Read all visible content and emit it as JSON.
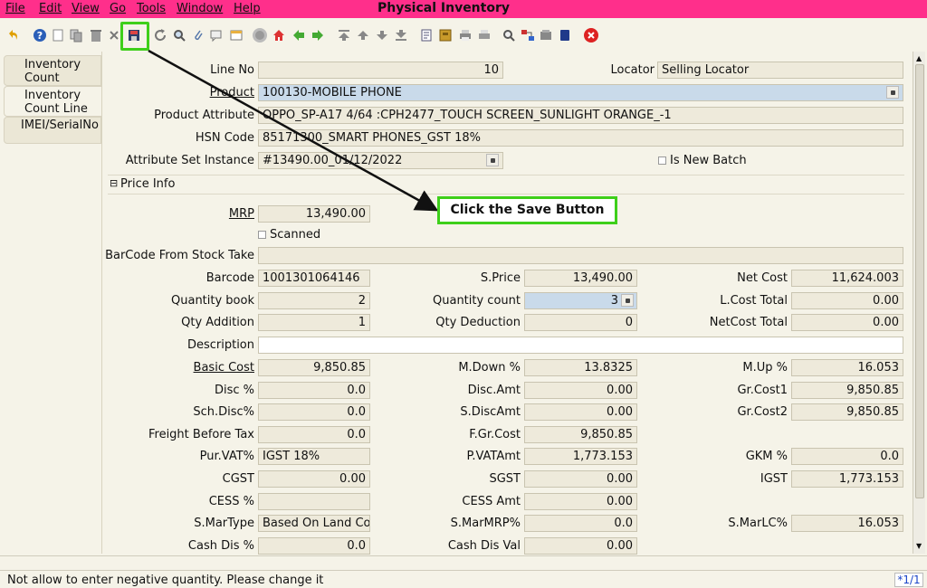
{
  "menu": [
    "File",
    "Edit",
    "View",
    "Go",
    "Tools",
    "Window",
    "Help"
  ],
  "app_title": "Physical Inventory",
  "toolbar_icons": [
    "undo-icon",
    "help-icon",
    "new-icon",
    "copy-icon",
    "delete-icon",
    "delete-selection-icon",
    "save-icon",
    "refresh-icon",
    "find-icon",
    "attachment-icon",
    "chat-icon",
    "history-icon",
    "home-icon",
    "parent-icon",
    "back-icon",
    "forward-icon",
    "first-icon",
    "previous-icon",
    "next-icon",
    "last-icon",
    "report-icon",
    "archive-icon",
    "print-icon",
    "print-preview-icon",
    "zoom-across-icon",
    "workflow-icon",
    "product-info-icon",
    "request-icon",
    "end-icon"
  ],
  "tabs": [
    "Inventory Count",
    "Inventory Count Line",
    "IMEI/SerialNo"
  ],
  "form": {
    "line_no_label": "Line No",
    "line_no": "10",
    "locator_label": "Locator",
    "locator": "Selling Locator",
    "product_label": "Product",
    "product": "100130-MOBILE PHONE",
    "product_attribute_label": "Product Attribute",
    "product_attribute": "OPPO_SP-A17 4/64 :CPH2477_TOUCH SCREEN_SUNLIGHT ORANGE_-1",
    "hsn_code_label": "HSN Code",
    "hsn_code": "85171300_SMART PHONES_GST 18%",
    "attribute_set_instance_label": "Attribute Set Instance",
    "attribute_set_instance": "#13490.00_01/12/2022",
    "is_new_batch_label": "Is New Batch",
    "price_info_label": "Price Info",
    "mrp_label": "MRP",
    "mrp": "13,490.00",
    "scanned_label": "Scanned",
    "barcode_from_stock_take_label": "BarCode From Stock Take",
    "barcode_from_stock_take": "",
    "barcode_label": "Barcode",
    "barcode": "1001301064146",
    "s_price_label": "S.Price",
    "s_price": "13,490.00",
    "net_cost_label": "Net Cost",
    "net_cost": "11,624.003",
    "quantity_book_label": "Quantity book",
    "quantity_book": "2",
    "quantity_count_label": "Quantity count",
    "quantity_count": "3",
    "l_cost_total_label": "L.Cost Total",
    "l_cost_total": "0.00",
    "qty_addition_label": "Qty Addition",
    "qty_addition": "1",
    "qty_deduction_label": "Qty Deduction",
    "qty_deduction": "0",
    "netcost_total_label": "NetCost Total",
    "netcost_total": "0.00",
    "description_label": "Description",
    "description": "",
    "basic_cost_label": "Basic Cost",
    "basic_cost": "9,850.85",
    "m_down_label": "M.Down %",
    "m_down": "13.8325",
    "m_up_label": "M.Up %",
    "m_up": "16.053",
    "disc_pct_label": "Disc %",
    "disc_pct": "0.0",
    "disc_amt_label": "Disc.Amt",
    "disc_amt": "0.00",
    "gr_cost1_label": "Gr.Cost1",
    "gr_cost1": "9,850.85",
    "sch_disc_label": "Sch.Disc%",
    "sch_disc": "0.0",
    "s_discamt_label": "S.DiscAmt",
    "s_discamt": "0.00",
    "gr_cost2_label": "Gr.Cost2",
    "gr_cost2": "9,850.85",
    "freight_label": "Freight Before Tax",
    "freight": "0.0",
    "f_gr_cost_label": "F.Gr.Cost",
    "f_gr_cost": "9,850.85",
    "pur_vat_label": "Pur.VAT%",
    "pur_vat": "IGST 18%",
    "p_vatamt_label": "P.VATAmt",
    "p_vatamt": "1,773.153",
    "gkm_label": "GKM %",
    "gkm": "0.0",
    "cgst_label": "CGST",
    "cgst": "0.00",
    "sgst_label": "SGST",
    "sgst": "0.00",
    "igst_label": "IGST",
    "igst": "1,773.153",
    "cess_pct_label": "CESS %",
    "cess_pct": "",
    "cess_amt_label": "CESS Amt",
    "cess_amt": "0.00",
    "s_martype_label": "S.MarType",
    "s_martype": "Based On Land Cost",
    "s_marmrp_label": "S.MarMRP%",
    "s_marmrp": "0.0",
    "s_marlc_label": "S.MarLC%",
    "s_marlc": "16.053",
    "cash_dis_pct_label": "Cash Dis %",
    "cash_dis_pct": "0.0",
    "cash_dis_val_label": "Cash Dis Val",
    "cash_dis_val": "0.00"
  },
  "callout": "Click the Save Button",
  "status": {
    "message": "Not allow to enter negative quantity. Please change it",
    "record_count": "*1/1"
  },
  "colors": {
    "menubar": "#ff2f8b",
    "highlight": "#3ecf1a",
    "background": "#f5f3e8"
  }
}
